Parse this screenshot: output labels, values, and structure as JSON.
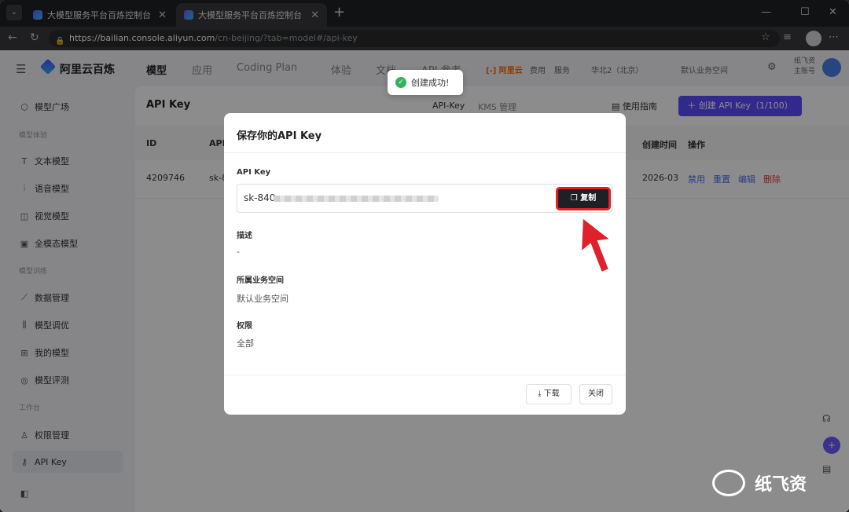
{
  "browser": {
    "tabs": [
      {
        "title": "大模型服务平台百炼控制台"
      },
      {
        "title": "大模型服务平台百炼控制台"
      }
    ],
    "url_host": "https://bailian.console.aliyun.com",
    "url_rest": "/cn-beijing/?tab=model#/api-key"
  },
  "header": {
    "brand": "阿里云百炼",
    "nav": [
      "模型",
      "应用",
      "Coding Plan",
      "体验",
      "文档",
      "API 参考"
    ],
    "aliyun": "[-] 阿里云",
    "links": [
      "费用",
      "服务"
    ],
    "region": "华北2（北京）",
    "workspace": "默认业务空间",
    "user_name": "纸飞资",
    "user_role": "主账号"
  },
  "sidebar": {
    "items": [
      {
        "label": "模型广场",
        "icon": "cube-icon"
      },
      {
        "group": "模型体验"
      },
      {
        "label": "文本模型",
        "icon": "text-icon"
      },
      {
        "label": "语音模型",
        "icon": "voice-icon"
      },
      {
        "label": "视觉模型",
        "icon": "camera-icon"
      },
      {
        "label": "全模态模型",
        "icon": "omni-icon"
      },
      {
        "group": "模型训练"
      },
      {
        "label": "数据管理",
        "icon": "chart-icon"
      },
      {
        "label": "模型调优",
        "icon": "sliders-icon"
      },
      {
        "label": "我的模型",
        "icon": "grid-icon"
      },
      {
        "label": "模型评测",
        "icon": "compass-icon"
      },
      {
        "group": "工作台"
      },
      {
        "label": "权限管理",
        "icon": "user-icon"
      },
      {
        "label": "API Key",
        "icon": "key-icon"
      }
    ]
  },
  "main": {
    "title": "API Key",
    "subtabs": [
      "API-Key",
      "KMS 管理"
    ],
    "guide": "使用指南",
    "create": "创建 API Key（1/100）",
    "columns": [
      "ID",
      "API",
      "创建时间",
      "操作"
    ],
    "row": {
      "id": "4209746",
      "key_prefix": "sk-8",
      "created": "2026-03"
    },
    "ops": [
      "禁用",
      "重置",
      "编辑",
      "删除"
    ]
  },
  "toast": {
    "text": "创建成功!"
  },
  "modal": {
    "title": "保存你的API Key",
    "key_label": "API Key",
    "key_value": "sk-840",
    "copy": "复制",
    "desc_label": "描述",
    "desc_value": "-",
    "ws_label": "所属业务空间",
    "ws_value": "默认业务空间",
    "perm_label": "权限",
    "perm_value": "全部",
    "download": "下载",
    "close": "关闭"
  },
  "watermark": {
    "text": "纸飞资"
  },
  "colors": {
    "accent": "#5b4cff",
    "danger": "#e53935",
    "link": "#4f6cf6",
    "highlight": "#e0202a"
  }
}
